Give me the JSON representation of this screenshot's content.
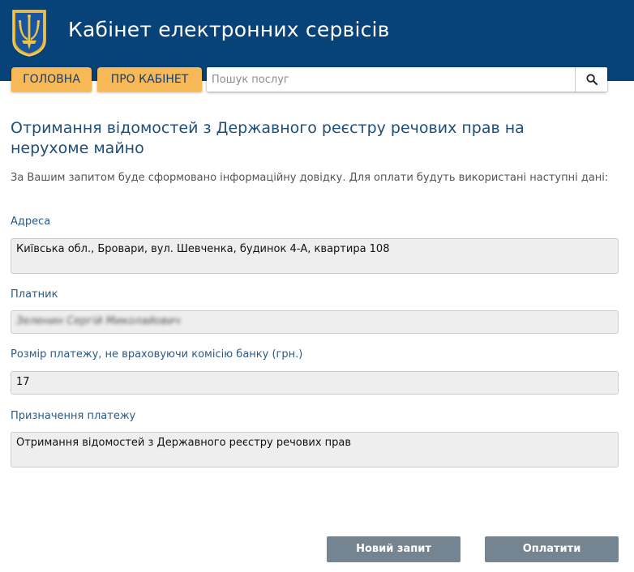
{
  "header": {
    "title": "Кабінет електронних сервісів",
    "logo_icon": "trident-shield-icon"
  },
  "nav": {
    "home_label": "ГОЛОВНА",
    "about_label": "ПРО КАБІНЕТ"
  },
  "search": {
    "placeholder": "Пошук послуг",
    "value": "",
    "button_icon": "search-icon"
  },
  "main": {
    "heading": "Отримання відомостей з Державного реєстру речових прав на нерухоме майно",
    "intro": "За Вашим запитом буде сформовано інформаційну довідку. Для оплати будуть використані наступні дані:",
    "fields": [
      {
        "label": "Адреса",
        "value": "Київська обл., Бровари, вул. Шевченка, будинок 4-А, квартира 108"
      },
      {
        "label": "Платник",
        "value": "Зеленин Сергій Миколайович",
        "redacted": true
      },
      {
        "label": "Розмір платежу, не враховуючи комісію банку (грн.)",
        "value": "17"
      },
      {
        "label": "Призначення платежу",
        "value": "Отримання відомостей з Державного реєстру речових прав"
      }
    ]
  },
  "actions": {
    "new_request_label": "Новий запит",
    "pay_label": "Оплатити"
  },
  "colors": {
    "header_bg": "#074278",
    "nav_button_bg": "#f7b858",
    "heading_text": "#1f4e7a",
    "label_text": "#2b5a84",
    "field_bg": "#eeeeee",
    "action_button_bg": "#758491"
  }
}
